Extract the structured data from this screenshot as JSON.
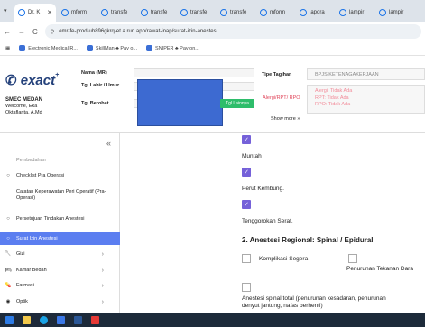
{
  "browser": {
    "tabs": [
      {
        "label": "Dr. K"
      },
      {
        "label": "mform"
      },
      {
        "label": "transfe"
      },
      {
        "label": "transfe"
      },
      {
        "label": "transfe"
      },
      {
        "label": "transfe"
      },
      {
        "label": "mform"
      },
      {
        "label": "lapora"
      },
      {
        "label": "lampir"
      },
      {
        "label": "lampir"
      }
    ],
    "url": "emr-fe-prod-uh896gkrq-et.a.run.app/rawat-inap/surat-izin-anestesi",
    "bookmarks": [
      "Electronic Medical R...",
      "SkillMan ♣ Pay o...",
      "SNIPER ♣ Pay on..."
    ]
  },
  "header": {
    "logo_text": "exact",
    "org_name": "SMEC MEDAN",
    "welcome": "Welcome, Eka",
    "user": "Oktaflarita, A.Md",
    "label_nama": "Nama (MR)",
    "label_tgl": "Tgl Lahir / Umur",
    "label_berobat": "Tgl Berobat",
    "green_btn": "Tgl Lainnya",
    "tipe_label": "Tipe Tagihan",
    "tipe_value": "BPJS KETENAGAKERJAAN",
    "alergi_label": "Alergi/RPT/ RPO",
    "alergi_lines": [
      "Alergi: Tidak Ada",
      "RPT: Tidak Ada",
      "RPO: Tidak Ada"
    ],
    "show_more": "Show more »"
  },
  "sidebar": {
    "items": [
      {
        "label": "Pembedahan"
      },
      {
        "label": "Checklist Pra Operasi"
      },
      {
        "label": "Catatan Keperawatan Peri Operatif (Pra-Operasi)"
      },
      {
        "label": "Persetujuan Tindakan Anestesi"
      },
      {
        "label": "Surat Izin Anestesi"
      },
      {
        "label": "Gizi"
      },
      {
        "label": "Kamar Bedah"
      },
      {
        "label": "Farmasi"
      },
      {
        "label": "Optik"
      }
    ]
  },
  "main": {
    "muntah": "Muntah",
    "perut": "Perut Kembung.",
    "tenggorokan": "Tenggorokan Serat.",
    "section": "2. Anestesi Regional: Spinal / Epidural",
    "komplikasi": "Komplikasi Segera",
    "penurunan": "Penurunan Tekanan Dara",
    "spinal_line1": "Anestesi spinal total (penurunan kesadaran, penurunan",
    "spinal_line2": "denyut jantung, nafas berhenti)"
  },
  "colors": {
    "accent": "#5b7ef0",
    "checkbox": "#7561d9",
    "alert": "#e0455a"
  }
}
